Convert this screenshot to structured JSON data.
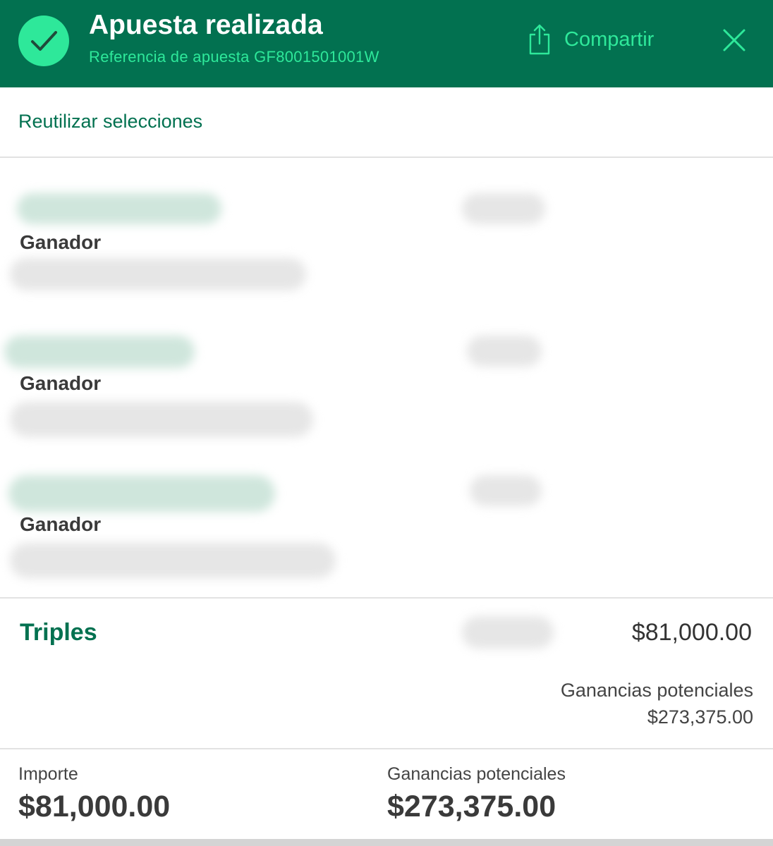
{
  "header": {
    "title": "Apuesta realizada",
    "reference": "Referencia de apuesta GF8001501001W",
    "share_label": "Compartir",
    "accent_color": "#2ee89a",
    "background_color": "#027150"
  },
  "reuse_link": "Reutilizar selecciones",
  "selections": [
    {
      "market": "Ganador"
    },
    {
      "market": "Ganador"
    },
    {
      "market": "Ganador"
    }
  ],
  "bet": {
    "type": "Triples",
    "stake": "$81,000.00",
    "potential_label": "Ganancias potenciales",
    "potential_value": "$273,375.00"
  },
  "footer": {
    "stake_label": "Importe",
    "stake_value": "$81,000.00",
    "potential_label": "Ganancias potenciales",
    "potential_value": "$273,375.00"
  },
  "icons": {
    "confirm": "check-circle-icon",
    "share": "share-icon",
    "close": "close-icon"
  }
}
